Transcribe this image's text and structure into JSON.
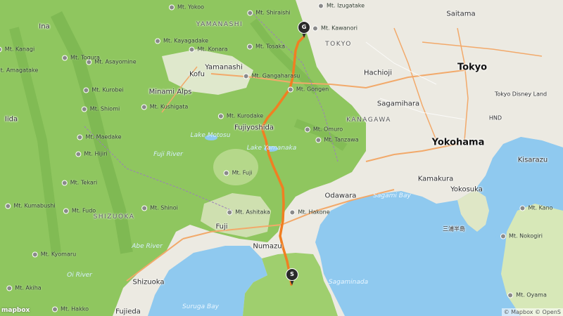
{
  "map": {
    "metros": {
      "tokyo": "Tokyo",
      "yokohama": "Yokohama"
    },
    "cities": {
      "saitama": "Saitama",
      "hachioji": "Hachioji",
      "sagamihara": "Sagamihara",
      "kofu": "Kofu",
      "yamanashi": "Yamanashi",
      "minami_alps": "Minami Alps",
      "ina": "Ina",
      "iida": "Iida",
      "fujiyoshida": "Fujiyoshida",
      "fuji": "Fuji",
      "numazu": "Numazu",
      "shizuoka": "Shizuoka",
      "fujieda": "Fujieda",
      "odawara": "Odawara",
      "kamakura": "Kamakura",
      "yokosuka": "Yokosuka",
      "kisarazu": "Kisarazu",
      "tokyo_disney": "Tokyo Disney Land",
      "hnd": "HND",
      "miura": "三浦半島"
    },
    "prefectures": {
      "yamanashi": "YAMANASHI",
      "tokyo": "TOKYO",
      "kanagawa": "KANAGAWA",
      "shizuoka": "SHIZUOKA"
    },
    "water": {
      "sagami_bay": "Sagami Bay",
      "sagaminada": "Sagaminada",
      "suruga_bay": "Suruga Bay",
      "lake_motosu": "Lake Motosu",
      "lake_yamanaka": "Lake Yamanaka",
      "fuji_river": "Fuji River",
      "abe_river": "Abe River",
      "oi_river": "Oi River"
    },
    "peaks": [
      {
        "name": "Mt. Yokoo"
      },
      {
        "name": "Mt. Shiraishi"
      },
      {
        "name": "Mt. Izugatake"
      },
      {
        "name": "Mt. Kawanori"
      },
      {
        "name": "Mt. Kayagadake"
      },
      {
        "name": "Mt. Konara"
      },
      {
        "name": "Mt. Tosaka"
      },
      {
        "name": "Mt. Gangaharasu"
      },
      {
        "name": "Mt. Gongen"
      },
      {
        "name": "Mt. Kurodake"
      },
      {
        "name": "Mt. Omuro"
      },
      {
        "name": "Mt. Tanzawa"
      },
      {
        "name": "Mt. Fuji"
      },
      {
        "name": "Mt. Ashitaka"
      },
      {
        "name": "Mt. Hakone"
      },
      {
        "name": "Mt. Shinoi"
      },
      {
        "name": "Mt. Togura"
      },
      {
        "name": "Mt. Asayomine"
      },
      {
        "name": "Mt. Kurobei"
      },
      {
        "name": "Mt. Shiomi"
      },
      {
        "name": "Mt. Kushigata"
      },
      {
        "name": "Mt. Maedake"
      },
      {
        "name": "Mt. Hijiri"
      },
      {
        "name": "Mt. Tekari"
      },
      {
        "name": "Mt. Kumabushi"
      },
      {
        "name": "Mt. Fudo"
      },
      {
        "name": "Mt. Kyomaru"
      },
      {
        "name": "Mt. Akiha"
      },
      {
        "name": "Mt. Hakko"
      },
      {
        "name": "Mt. Kano"
      },
      {
        "name": "Mt. Nokogiri"
      },
      {
        "name": "Mt. Oyama"
      },
      {
        "name": "Mt. Kanagi"
      },
      {
        "name": "Mt. Amagatake"
      }
    ],
    "markers": {
      "start": "S",
      "goal": "G"
    },
    "route_color": "#f07f22",
    "attribution": "© Mapbox © OpenS",
    "logo": "mapbox"
  }
}
